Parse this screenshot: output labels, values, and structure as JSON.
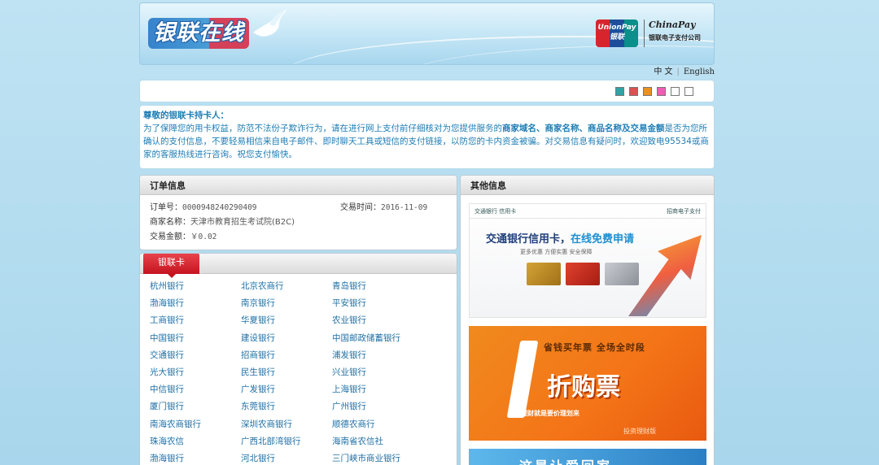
{
  "header": {
    "logo_text": "银联在线",
    "unionpay_label": "UnionPay 银联",
    "chinapay_name": "ChinaPay",
    "chinapay_sub": "银联电子支付公司"
  },
  "lang": {
    "zh": "中 文",
    "en": "English"
  },
  "skins": [
    "#2fa3a6",
    "#d9534f",
    "#e8921f",
    "#ec5fb4",
    "#ffffff",
    "#ffffff"
  ],
  "notice": {
    "title": "尊敬的银联卡持卡人：",
    "text_before": "为了保障您的用卡权益，防范不法份子欺诈行为，请在进行网上支付前仔细核对为您提供服务的",
    "highlight": "商家域名、商家名称、商品名称及交易金额",
    "text_after": "是否为您所确认的支付信息，不要轻易相信来自电子邮件、即时聊天工具或短信的支付链接，以防您的卡内资金被骗。对交易信息有疑问时，欢迎致电95534或商家的客服热线进行咨询。祝您支付愉快。"
  },
  "order": {
    "title": "订单信息",
    "order_no_label": "订单号：",
    "order_no": "0000948240290409",
    "time_label": "交易时间：",
    "time": "2016-11-09",
    "merchant_label": "商家名称：",
    "merchant": "天津市教育招生考试院(B2C)",
    "amount_label": "交易金额：",
    "amount": "￥0.02"
  },
  "banks": {
    "tab": "银联卡",
    "list": [
      "杭州银行",
      "北京农商行",
      "青岛银行",
      "渤海银行",
      "南京银行",
      "平安银行",
      "工商银行",
      "华夏银行",
      "农业银行",
      "中国银行",
      "建设银行",
      "中国邮政储蓄银行",
      "交通银行",
      "招商银行",
      "浦发银行",
      "光大银行",
      "民生银行",
      "兴业银行",
      "中信银行",
      "广发银行",
      "上海银行",
      "厦门银行",
      "东莞银行",
      "广州银行",
      "南海农商银行",
      "深圳农商银行",
      "顺德农商行",
      "珠海农信",
      "广西北部湾银行",
      "海南省农信社",
      "渤海银行",
      "河北银行",
      "三门峡市商业银行"
    ]
  },
  "other": {
    "title": "其他信息",
    "ad1": {
      "brand": "交通银行 信用卡",
      "partner": "招商电子支付",
      "headline": "交通银行信用卡，",
      "headline_em": "在线免费申请",
      "sub": "更多优惠   方便实惠   安全保障"
    },
    "ad2": {
      "frame": "省钱买年票 全场全时段",
      "big": "折购票",
      "slogan": "理财就是要价理划来",
      "corner": "投资理财版"
    },
    "ad3": {
      "text": "这是让爱回家"
    }
  }
}
